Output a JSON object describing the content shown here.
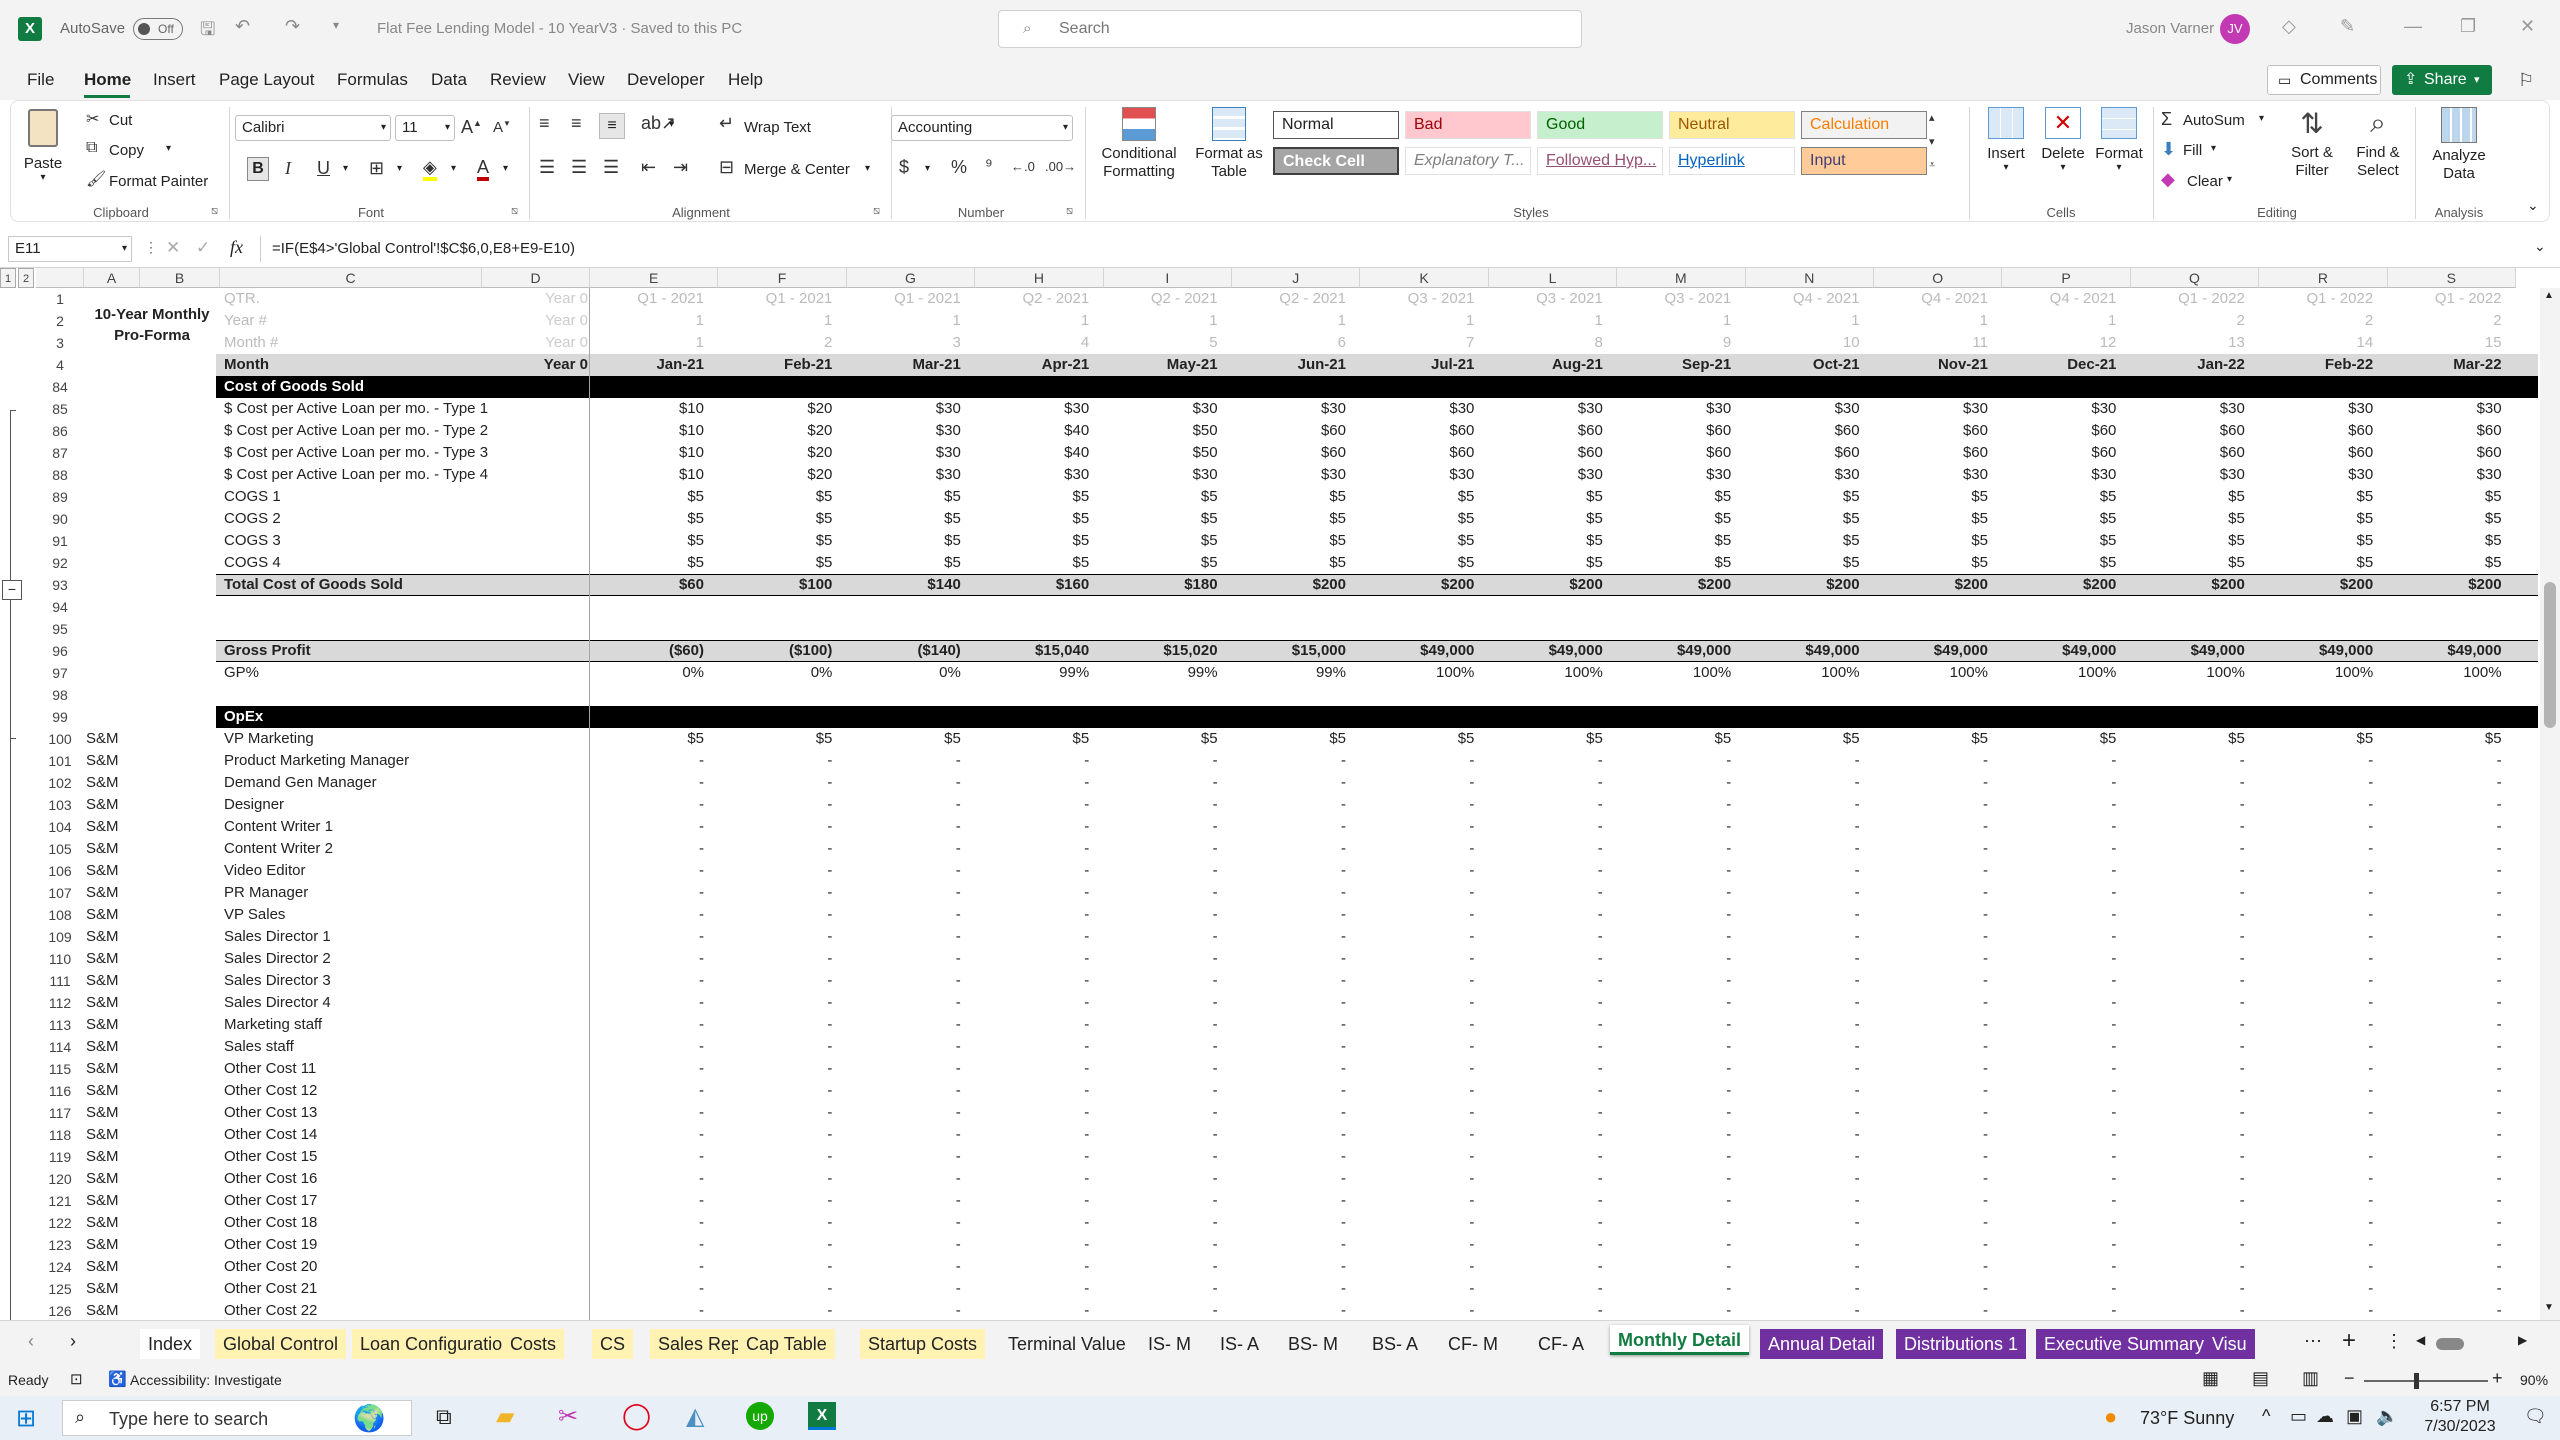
{
  "title": {
    "autosave": "AutoSave",
    "autosave_state": "Off",
    "doc": "Flat Fee Lending Model - 10 YearV3  ·  Saved to this PC",
    "search_placeholder": "Search",
    "user": "Jason Varner",
    "initials": "JV"
  },
  "menu": [
    "File",
    "Home",
    "Insert",
    "Page Layout",
    "Formulas",
    "Data",
    "Review",
    "View",
    "Developer",
    "Help"
  ],
  "menu_right": {
    "comments": "Comments",
    "share": "Share"
  },
  "ribbon": {
    "clipboard": {
      "paste": "Paste",
      "cut": "Cut",
      "copy": "Copy",
      "format_painter": "Format Painter",
      "group": "Clipboard"
    },
    "font": {
      "family": "Calibri",
      "size": "11",
      "group": "Font"
    },
    "alignment": {
      "wrap": "Wrap Text",
      "merge": "Merge & Center",
      "group": "Alignment"
    },
    "number": {
      "format": "Accounting",
      "group": "Number"
    },
    "styles": {
      "cond_format": "Conditional Formatting",
      "format_table": "Format as Table",
      "cells": [
        {
          "label": "Normal",
          "bg": "#ffffff",
          "fg": "#222222"
        },
        {
          "label": "Bad",
          "bg": "#ffc7ce",
          "fg": "#9c0006"
        },
        {
          "label": "Good",
          "bg": "#c6efce",
          "fg": "#006100"
        },
        {
          "label": "Neutral",
          "bg": "#ffeb9c",
          "fg": "#9c5700"
        },
        {
          "label": "Calculation",
          "bg": "#f2f2f2",
          "fg": "#fa7d00"
        },
        {
          "label": "Check Cell",
          "bg": "#a5a5a5",
          "fg": "#ffffff"
        },
        {
          "label": "Explanatory T...",
          "bg": "#ffffff",
          "fg": "#7f7f7f"
        },
        {
          "label": "Followed Hyp...",
          "bg": "#ffffff",
          "fg": "#954f72"
        },
        {
          "label": "Hyperlink",
          "bg": "#ffffff",
          "fg": "#0563c1"
        },
        {
          "label": "Input",
          "bg": "#ffcc99",
          "fg": "#3f3f76"
        }
      ],
      "group": "Styles"
    },
    "cells": {
      "insert": "Insert",
      "delete": "Delete",
      "format": "Format",
      "group": "Cells"
    },
    "editing": {
      "autosum": "AutoSum",
      "fill": "Fill",
      "clear": "Clear",
      "sort": "Sort & Filter",
      "find": "Find & Select",
      "group": "Editing"
    },
    "analysis": {
      "analyze": "Analyze Data",
      "group": "Analysis"
    }
  },
  "formula_bar": {
    "name_box": "E11",
    "fx": "fx",
    "formula": "=IF(E$4>'Global Control'!$C$6,0,E8+E9-E10)"
  },
  "columns": {
    "left": [
      "A",
      "B",
      "C",
      "D"
    ],
    "values": [
      "E",
      "F",
      "G",
      "H",
      "I",
      "J",
      "K",
      "L",
      "M",
      "N",
      "O",
      "P",
      "Q",
      "R",
      "S"
    ]
  },
  "header_rows": [
    {
      "n": "1",
      "c": "QTR.",
      "d": "Year 0",
      "vals": [
        "Q1 - 2021",
        "Q1 - 2021",
        "Q1 - 2021",
        "Q2 - 2021",
        "Q2 - 2021",
        "Q2 - 2021",
        "Q3 - 2021",
        "Q3 - 2021",
        "Q3 - 2021",
        "Q4 - 2021",
        "Q4 - 2021",
        "Q4 - 2021",
        "Q1 - 2022",
        "Q1 - 2022",
        "Q1 - 2022"
      ]
    },
    {
      "n": "2",
      "c": "Year #",
      "d": "Year 0",
      "vals": [
        "1",
        "1",
        "1",
        "1",
        "1",
        "1",
        "1",
        "1",
        "1",
        "1",
        "1",
        "1",
        "2",
        "2",
        "2"
      ]
    },
    {
      "n": "3",
      "c": "Month #",
      "d": "Year 0",
      "vals": [
        "1",
        "2",
        "3",
        "4",
        "5",
        "6",
        "7",
        "8",
        "9",
        "10",
        "11",
        "12",
        "13",
        "14",
        "15"
      ]
    },
    {
      "n": "4",
      "c": "Month",
      "d": "Year 0",
      "vals": [
        "Jan-21",
        "Feb-21",
        "Mar-21",
        "Apr-21",
        "May-21",
        "Jun-21",
        "Jul-21",
        "Aug-21",
        "Sep-21",
        "Oct-21",
        "Nov-21",
        "Dec-21",
        "Jan-22",
        "Feb-22",
        "Mar-22"
      ]
    }
  ],
  "model_title": "10-Year Monthly Pro-Forma",
  "body_rows": [
    {
      "n": "84",
      "kind": "section",
      "c": "Cost of Goods Sold"
    },
    {
      "n": "85",
      "c": "$ Cost per Active Loan per mo. - Type 1",
      "vals": [
        "$10",
        "$20",
        "$30",
        "$30",
        "$30",
        "$30",
        "$30",
        "$30",
        "$30",
        "$30",
        "$30",
        "$30",
        "$30",
        "$30",
        "$30"
      ]
    },
    {
      "n": "86",
      "c": "$ Cost per Active Loan per mo. - Type 2",
      "vals": [
        "$10",
        "$20",
        "$30",
        "$40",
        "$50",
        "$60",
        "$60",
        "$60",
        "$60",
        "$60",
        "$60",
        "$60",
        "$60",
        "$60",
        "$60"
      ]
    },
    {
      "n": "87",
      "c": "$ Cost per Active Loan per mo. - Type 3",
      "vals": [
        "$10",
        "$20",
        "$30",
        "$40",
        "$50",
        "$60",
        "$60",
        "$60",
        "$60",
        "$60",
        "$60",
        "$60",
        "$60",
        "$60",
        "$60"
      ]
    },
    {
      "n": "88",
      "c": "$ Cost per Active Loan per mo. - Type 4",
      "vals": [
        "$10",
        "$20",
        "$30",
        "$30",
        "$30",
        "$30",
        "$30",
        "$30",
        "$30",
        "$30",
        "$30",
        "$30",
        "$30",
        "$30",
        "$30"
      ]
    },
    {
      "n": "89",
      "c": "COGS 1",
      "vals": [
        "$5",
        "$5",
        "$5",
        "$5",
        "$5",
        "$5",
        "$5",
        "$5",
        "$5",
        "$5",
        "$5",
        "$5",
        "$5",
        "$5",
        "$5"
      ]
    },
    {
      "n": "90",
      "c": "COGS 2",
      "vals": [
        "$5",
        "$5",
        "$5",
        "$5",
        "$5",
        "$5",
        "$5",
        "$5",
        "$5",
        "$5",
        "$5",
        "$5",
        "$5",
        "$5",
        "$5"
      ]
    },
    {
      "n": "91",
      "c": "COGS 3",
      "vals": [
        "$5",
        "$5",
        "$5",
        "$5",
        "$5",
        "$5",
        "$5",
        "$5",
        "$5",
        "$5",
        "$5",
        "$5",
        "$5",
        "$5",
        "$5"
      ]
    },
    {
      "n": "92",
      "c": "COGS 4",
      "vals": [
        "$5",
        "$5",
        "$5",
        "$5",
        "$5",
        "$5",
        "$5",
        "$5",
        "$5",
        "$5",
        "$5",
        "$5",
        "$5",
        "$5",
        "$5"
      ]
    },
    {
      "n": "93",
      "kind": "total",
      "c": "Total Cost of Goods Sold",
      "vals": [
        "$60",
        "$100",
        "$140",
        "$160",
        "$180",
        "$200",
        "$200",
        "$200",
        "$200",
        "$200",
        "$200",
        "$200",
        "$200",
        "$200",
        "$200"
      ]
    },
    {
      "n": "94",
      "c": ""
    },
    {
      "n": "95",
      "c": ""
    },
    {
      "n": "96",
      "kind": "total",
      "c": "Gross Profit",
      "vals": [
        "($60)",
        "($100)",
        "($140)",
        "$15,040",
        "$15,020",
        "$15,000",
        "$49,000",
        "$49,000",
        "$49,000",
        "$49,000",
        "$49,000",
        "$49,000",
        "$49,000",
        "$49,000",
        "$49,000"
      ]
    },
    {
      "n": "97",
      "c": "GP%",
      "vals": [
        "0%",
        "0%",
        "0%",
        "99%",
        "99%",
        "99%",
        "100%",
        "100%",
        "100%",
        "100%",
        "100%",
        "100%",
        "100%",
        "100%",
        "100%"
      ]
    },
    {
      "n": "98",
      "c": ""
    },
    {
      "n": "99",
      "kind": "section",
      "c": "OpEx"
    },
    {
      "n": "100",
      "a": "S&M",
      "c": "VP Marketing",
      "vals": [
        "$5",
        "$5",
        "$5",
        "$5",
        "$5",
        "$5",
        "$5",
        "$5",
        "$5",
        "$5",
        "$5",
        "$5",
        "$5",
        "$5",
        "$5"
      ]
    },
    {
      "n": "101",
      "a": "S&M",
      "c": "Product Marketing Manager",
      "dash": true
    },
    {
      "n": "102",
      "a": "S&M",
      "c": "Demand Gen Manager",
      "dash": true
    },
    {
      "n": "103",
      "a": "S&M",
      "c": "Designer",
      "dash": true
    },
    {
      "n": "104",
      "a": "S&M",
      "c": "Content Writer 1",
      "dash": true
    },
    {
      "n": "105",
      "a": "S&M",
      "c": "Content Writer 2",
      "dash": true
    },
    {
      "n": "106",
      "a": "S&M",
      "c": "Video Editor",
      "dash": true
    },
    {
      "n": "107",
      "a": "S&M",
      "c": "PR Manager",
      "dash": true
    },
    {
      "n": "108",
      "a": "S&M",
      "c": "VP Sales",
      "dash": true
    },
    {
      "n": "109",
      "a": "S&M",
      "c": "Sales Director 1",
      "dash": true
    },
    {
      "n": "110",
      "a": "S&M",
      "c": "Sales Director 2",
      "dash": true
    },
    {
      "n": "111",
      "a": "S&M",
      "c": "Sales Director 3",
      "dash": true
    },
    {
      "n": "112",
      "a": "S&M",
      "c": "Sales Director 4",
      "dash": true
    },
    {
      "n": "113",
      "a": "S&M",
      "c": "Marketing staff",
      "dash": true
    },
    {
      "n": "114",
      "a": "S&M",
      "c": "Sales staff",
      "dash": true
    },
    {
      "n": "115",
      "a": "S&M",
      "c": "Other Cost 11",
      "dash": true
    },
    {
      "n": "116",
      "a": "S&M",
      "c": "Other Cost 12",
      "dash": true
    },
    {
      "n": "117",
      "a": "S&M",
      "c": "Other Cost 13",
      "dash": true
    },
    {
      "n": "118",
      "a": "S&M",
      "c": "Other Cost 14",
      "dash": true
    },
    {
      "n": "119",
      "a": "S&M",
      "c": "Other Cost 15",
      "dash": true
    },
    {
      "n": "120",
      "a": "S&M",
      "c": "Other Cost 16",
      "dash": true
    },
    {
      "n": "121",
      "a": "S&M",
      "c": "Other Cost 17",
      "dash": true
    },
    {
      "n": "122",
      "a": "S&M",
      "c": "Other Cost 18",
      "dash": true
    },
    {
      "n": "123",
      "a": "S&M",
      "c": "Other Cost 19",
      "dash": true
    },
    {
      "n": "124",
      "a": "S&M",
      "c": "Other Cost 20",
      "dash": true
    },
    {
      "n": "125",
      "a": "S&M",
      "c": "Other Cost 21",
      "dash": true
    },
    {
      "n": "126",
      "a": "S&M",
      "c": "Other Cost 22",
      "dash": true
    }
  ],
  "dash": "-",
  "sheet_tabs": [
    {
      "label": "Index",
      "color": "#ffffff"
    },
    {
      "label": "Global Control",
      "color": "#fff2b3"
    },
    {
      "label": "Loan Configuration",
      "color": "#fff2b3"
    },
    {
      "label": "Costs",
      "color": "#fff2b3"
    },
    {
      "label": "CS",
      "color": "#fff2b3"
    },
    {
      "label": "Sales Reps",
      "color": "#fff2b3"
    },
    {
      "label": "Cap Table",
      "color": "#fff2b3"
    },
    {
      "label": "Startup Costs",
      "color": "#fff2b3"
    },
    {
      "label": "Terminal Value",
      "color": "#f3f3f3"
    },
    {
      "label": "IS- M",
      "color": "#f3f3f3"
    },
    {
      "label": "IS- A",
      "color": "#f3f3f3"
    },
    {
      "label": "BS- M",
      "color": "#f3f3f3"
    },
    {
      "label": "BS- A",
      "color": "#f3f3f3"
    },
    {
      "label": "CF- M",
      "color": "#f3f3f3"
    },
    {
      "label": "CF- A",
      "color": "#f3f3f3"
    },
    {
      "label": "Monthly Detail",
      "color": "#ffffff",
      "active": true
    },
    {
      "label": "Annual Detail",
      "color": "#7030a0",
      "fg": "#ffffff"
    },
    {
      "label": "Distributions 1",
      "color": "#7030a0",
      "fg": "#ffffff"
    },
    {
      "label": "Executive Summary",
      "color": "#7030a0",
      "fg": "#ffffff"
    },
    {
      "label": "Visu",
      "color": "#7030a0",
      "fg": "#ffffff"
    }
  ],
  "status": {
    "ready": "Ready",
    "accessibility": "Accessibility: Investigate",
    "zoom": "90%"
  },
  "taskbar": {
    "search": "Type here to search",
    "weather": "73°F  Sunny",
    "time": "6:57 PM",
    "date": "7/30/2023"
  },
  "colors": {
    "excel_green": "#107c41",
    "black_band": "#000000",
    "purple_tab": "#7030a0"
  }
}
